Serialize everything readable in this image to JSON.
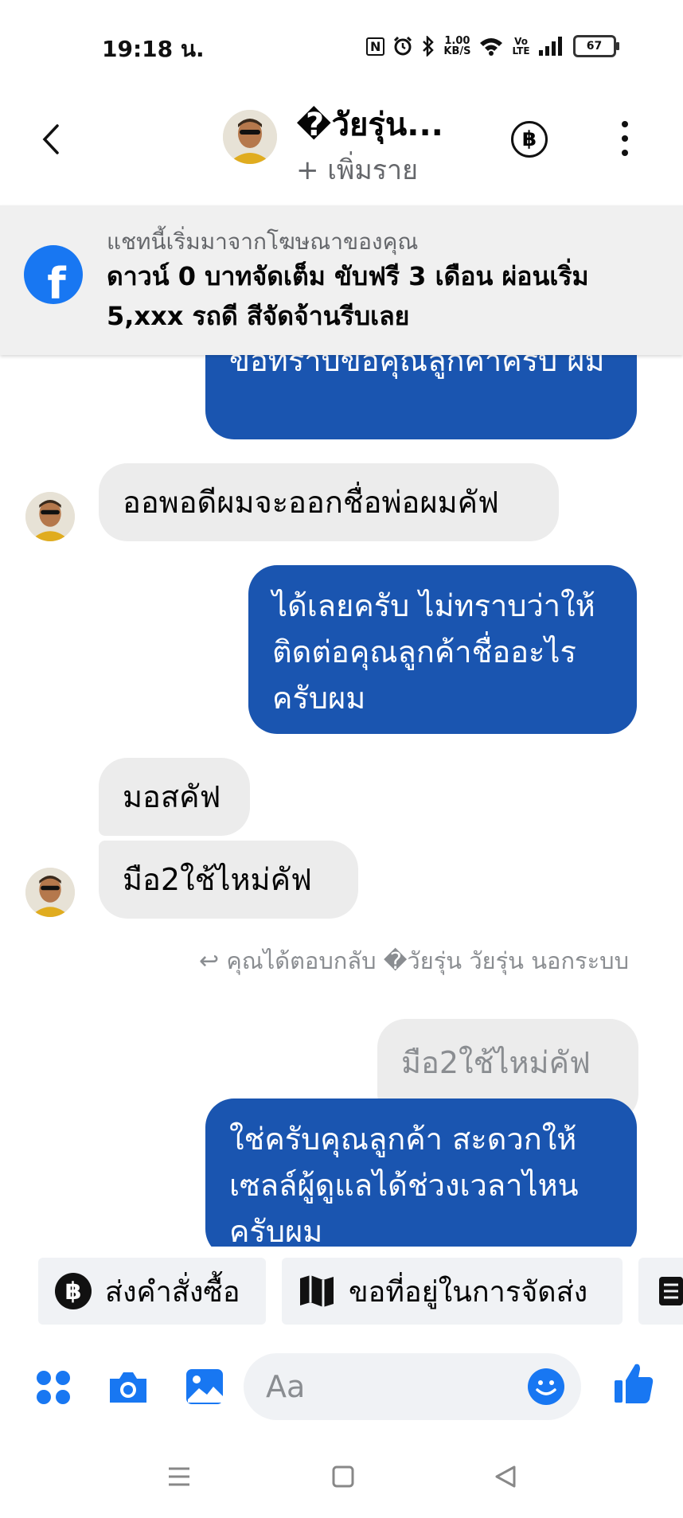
{
  "status": {
    "time": "19:18 น.",
    "speed_value": "1.00",
    "speed_unit": "KB/S",
    "volte_top": "Vo",
    "volte_bottom": "LTE",
    "battery": "67"
  },
  "header": {
    "title": "�วัยรุ่น...",
    "subtitle": "+ เพิ่มราย"
  },
  "banner": {
    "subtitle": "แชทนี้เริ่มมาจากโฆษณาของคุณ",
    "title": "ดาวน์ 0 บาทจัดเต็ม ขับฟรี 3 เดือน ผ่อนเริ่ม 5,xxx รถดี สีจัดจ้านรีบเลย"
  },
  "messages": [
    {
      "side": "out",
      "text": "ข้อทราบข้อคุณลูกค้าครับ ผม"
    },
    {
      "side": "in",
      "text": "ออพอดีผมจะออกชื่อพ่อผมคัฟ"
    },
    {
      "side": "out",
      "text": "ได้เลยครับ ไม่ทราบว่าให้ติดต่อคุณลูกค้าชื่ออะไรครับผม"
    },
    {
      "side": "in",
      "text": "มอสคัฟ"
    },
    {
      "side": "in",
      "text": "มือ2ใช้ไหม่คัฟ"
    },
    {
      "side": "out",
      "text": "ใช่ครับคุณลูกค้า สะดวกให้เซลล์ผู้ดูแลได้ช่วงเวลาไหนครับผม"
    }
  ],
  "reply": {
    "note": "คุณได้ตอบกลับ �วัยรุ่น วัยรุ่น นอกระบบ",
    "quoted": "มือ2ใช้ไหม่คัฟ"
  },
  "quick_replies": [
    {
      "label": "ส่งคำสั่งซื้อ",
      "icon": "baht-circle-icon"
    },
    {
      "label": "ขอที่อยู่ในการจัดส่ง",
      "icon": "map-icon"
    }
  ],
  "composer": {
    "placeholder": "Aa"
  }
}
